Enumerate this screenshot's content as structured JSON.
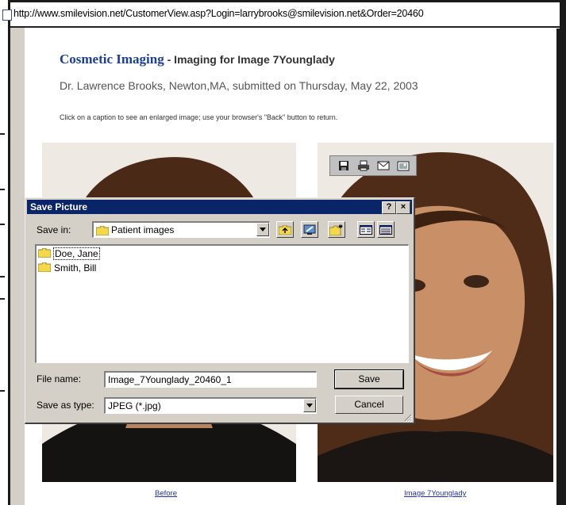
{
  "browser": {
    "address": "http://www.smilevision.net/CustomerView.asp?Login=larrybrooks@smilevision.net&Order=20460"
  },
  "page": {
    "brand": "Cosmetic Imaging",
    "subheading": " - Imaging for Image 7Younglady",
    "doctor_line": "Dr. Lawrence Brooks, Newton,MA, submitted on Thursday, May 22, 2003",
    "instruction": "Click on a caption to see an enlarged image; use your browser's \"Back\" button to return.",
    "captions": {
      "before": "Before",
      "after": "Image 7Younglady"
    }
  },
  "image_toolbar": {
    "icons": [
      "save-icon",
      "print-icon",
      "mail-icon",
      "my-pictures-icon"
    ]
  },
  "dialog": {
    "title": "Save Picture",
    "help_glyph": "?",
    "close_glyph": "×",
    "save_in_label": "Save in:",
    "save_in_value": "Patient images",
    "files": [
      "Doe, Jane",
      "Smith, Bill"
    ],
    "file_name_label": "File name:",
    "file_name_value": "Image_7Younglady_20460_1",
    "save_as_type_label": "Save as type:",
    "save_as_type_value": "JPEG (*.jpg)",
    "save_label": "Save",
    "cancel_label": "Cancel"
  },
  "colors": {
    "title_bar": "#0a246a",
    "dialog_face": "#d4d0c8",
    "brand": "#1c3e96",
    "link": "#2433b0"
  }
}
